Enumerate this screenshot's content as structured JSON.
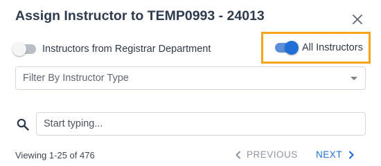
{
  "dialog": {
    "title": "Assign Instructor to TEMP0993 - 24013",
    "close_icon": "close-icon"
  },
  "toggles": {
    "registrar": {
      "label": "Instructors from Registrar Department",
      "on": false
    },
    "all": {
      "label": "All Instructors",
      "on": true,
      "highlight_color": "#f5a518"
    }
  },
  "filter": {
    "selected": "Filter By Instructor Type",
    "icon": "chevron-down-icon"
  },
  "search": {
    "placeholder": "Start typing...",
    "icon": "search-icon"
  },
  "pagination": {
    "viewing": "Viewing 1-25 of 476",
    "previous": "PREVIOUS",
    "next": "NEXT"
  },
  "colors": {
    "accent": "#1f6fd6",
    "disabled": "#8d959f",
    "title": "#2e3a4d"
  }
}
